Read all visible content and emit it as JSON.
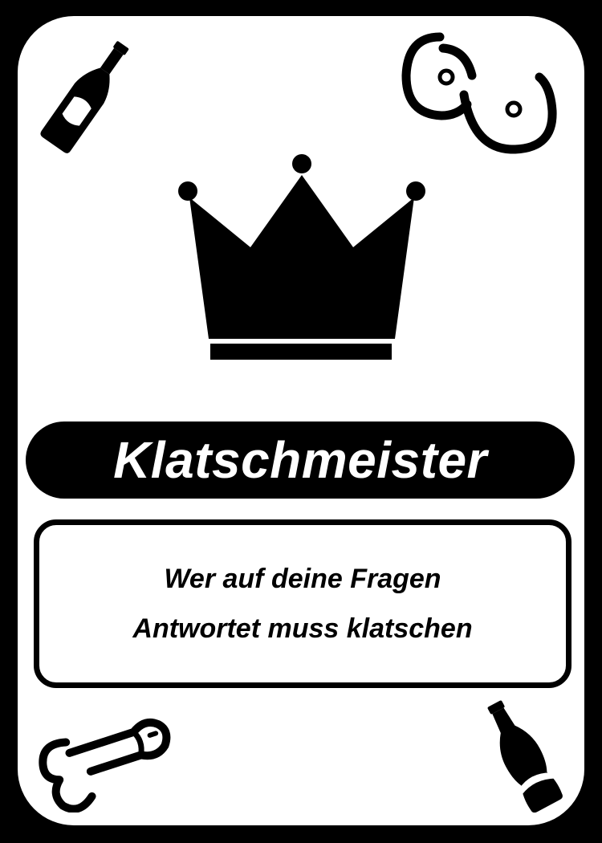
{
  "card": {
    "title": "Klatschmeister",
    "description_lines": [
      "Wer auf deine Fragen",
      "Antwortet muss klatschen"
    ]
  },
  "icons": {
    "top_left": "beer-bottle-icon",
    "top_right": "breasts-icon",
    "center": "crown-icon",
    "bottom_left": "penis-icon",
    "bottom_right": "cola-bottle-icon"
  },
  "colors": {
    "background": "#000000",
    "card": "#ffffff",
    "ink": "#000000"
  }
}
